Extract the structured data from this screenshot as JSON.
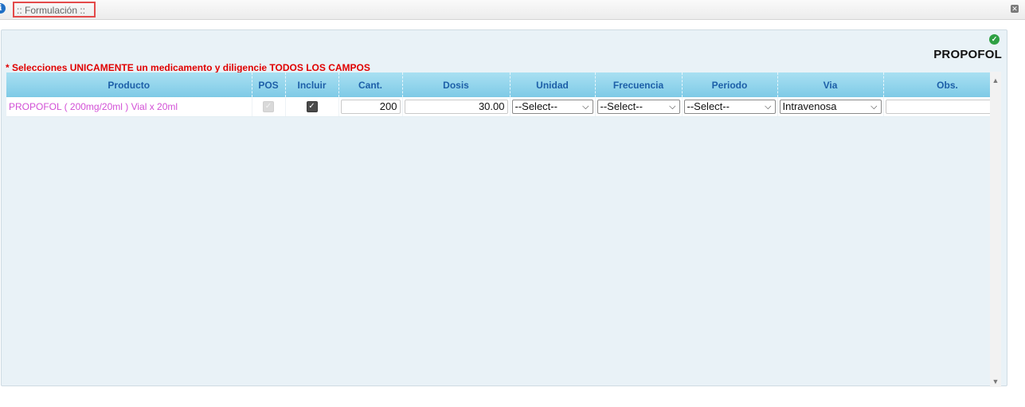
{
  "window": {
    "title": ":: Formulación ::"
  },
  "panel": {
    "drug_title": "PROPOFOL",
    "note": "* Selecciones UNICAMENTE un medicamento y diligencie TODOS LOS CAMPOS"
  },
  "icons": {
    "info": "info-icon",
    "close": "close-icon",
    "ok": "check-circle-icon",
    "ok_color": "#2ea043"
  },
  "colors": {
    "header_bg": "#7ecae6",
    "header_text": "#1d5fa8",
    "note_text": "#e00000",
    "product_text": "#d24fd6",
    "panel_bg": "#e9f2f7"
  },
  "table": {
    "headers": {
      "producto": "Producto",
      "pos": "POS",
      "incluir": "Incluir",
      "cant": "Cant.",
      "dosis": "Dosis",
      "unidad": "Unidad",
      "frecuencia": "Frecuencia",
      "periodo": "Periodo",
      "via": "Via",
      "obs": "Obs."
    },
    "rows": [
      {
        "producto": "PROPOFOL ( 200mg/20ml ) Vial x 20ml",
        "pos_checked": true,
        "pos_disabled": true,
        "incluir_checked": true,
        "cant": "200",
        "dosis": "30.00",
        "unidad": "--Select--",
        "frecuencia": "--Select--",
        "periodo": "--Select--",
        "via": "Intravenosa",
        "obs": ""
      }
    ]
  }
}
